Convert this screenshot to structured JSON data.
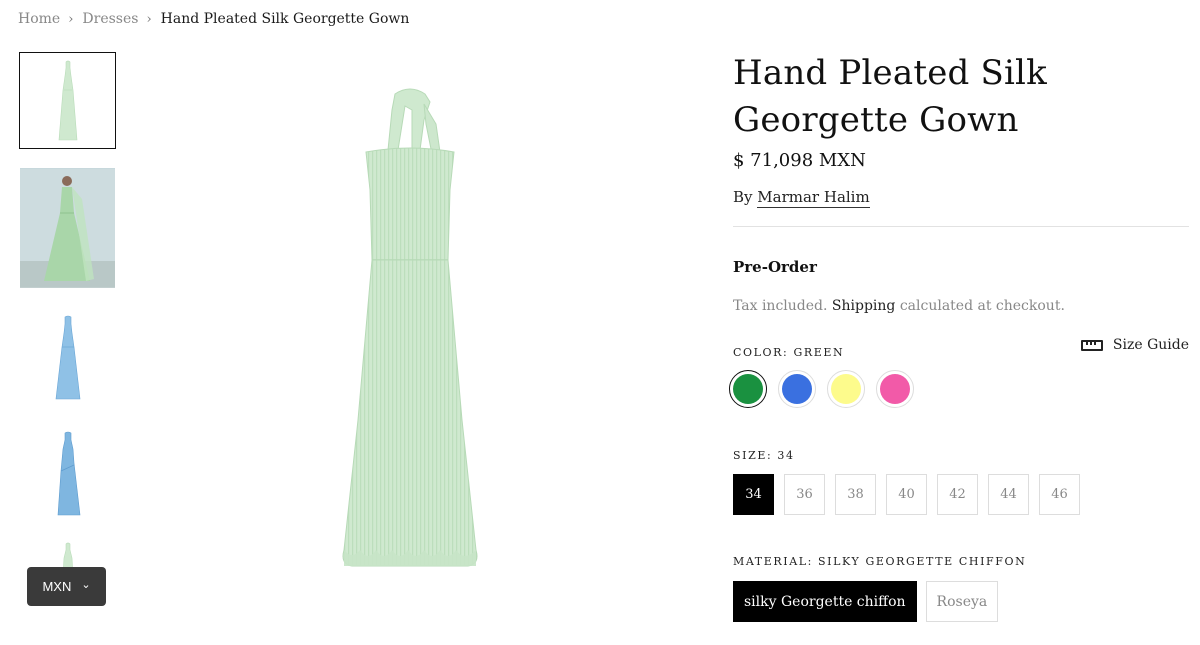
{
  "breadcrumb": {
    "home": "Home",
    "category": "Dresses",
    "current": "Hand Pleated Silk Georgette Gown"
  },
  "product": {
    "title_line1": "Hand Pleated Silk",
    "title_line2": "Georgette Gown",
    "price": "$ 71,098 MXN",
    "by_label": "By",
    "vendor": "Marmar Halim",
    "availability": "Pre-Order",
    "tax_prefix": "Tax included.",
    "shipping_link": "Shipping",
    "tax_suffix": "calculated at checkout."
  },
  "options": {
    "color_label": "COLOR: GREEN",
    "size_guide": "Size Guide",
    "colors": [
      {
        "name": "green",
        "hex": "#1a9140",
        "selected": true
      },
      {
        "name": "blue",
        "hex": "#3a70e0",
        "selected": false
      },
      {
        "name": "yellow",
        "hex": "#fdfb8c",
        "selected": false
      },
      {
        "name": "pink",
        "hex": "#f25aa8",
        "selected": false
      }
    ],
    "size_label": "SIZE: 34",
    "sizes": [
      "34",
      "36",
      "38",
      "40",
      "42",
      "44",
      "46"
    ],
    "selected_size": "34",
    "material_label": "MATERIAL: SILKY GEORGETTE CHIFFON",
    "materials": [
      "silky Georgette chiffon",
      "Roseya"
    ],
    "selected_material": "silky Georgette chiffon"
  },
  "currency_selector": {
    "value": "MXN"
  },
  "gallery": {
    "dress_colors": {
      "green": "#cfe9cf",
      "green_shade": "#b9dcb9",
      "blue": "#8fc1e6",
      "blue_shade": "#6aa6d6"
    }
  }
}
